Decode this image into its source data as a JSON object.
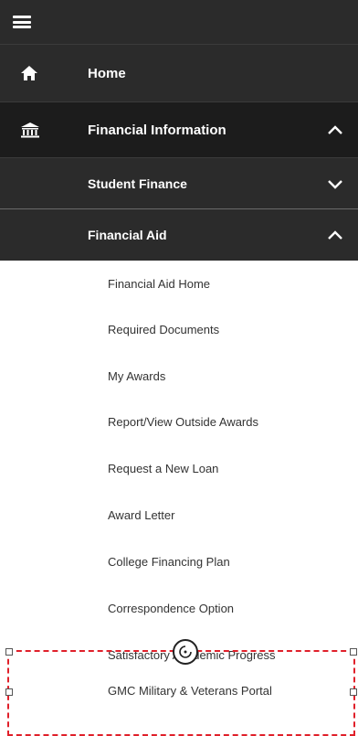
{
  "nav": {
    "home_label": "Home",
    "financial_info_label": "Financial Information",
    "student_finance_label": "Student Finance",
    "financial_aid_label": "Financial Aid"
  },
  "icons": {
    "menu": "hamburger-icon",
    "home": "home-icon",
    "financial": "bank-icon",
    "expand": "chevron-down-icon",
    "collapse": "chevron-up-icon"
  },
  "financial_aid_items": [
    "Financial Aid Home",
    "Required Documents",
    "My Awards",
    "Report/View Outside Awards",
    "Request a New Loan",
    "Award Letter",
    "College Financing Plan",
    "Correspondence Option",
    "Satisfactory Academic Progress",
    "GMC Military & Veterans Portal"
  ],
  "colors": {
    "nav_bg": "#2b2b2b",
    "nav_active_bg": "#1c1c1c",
    "highlight_border": "#e0202a"
  }
}
